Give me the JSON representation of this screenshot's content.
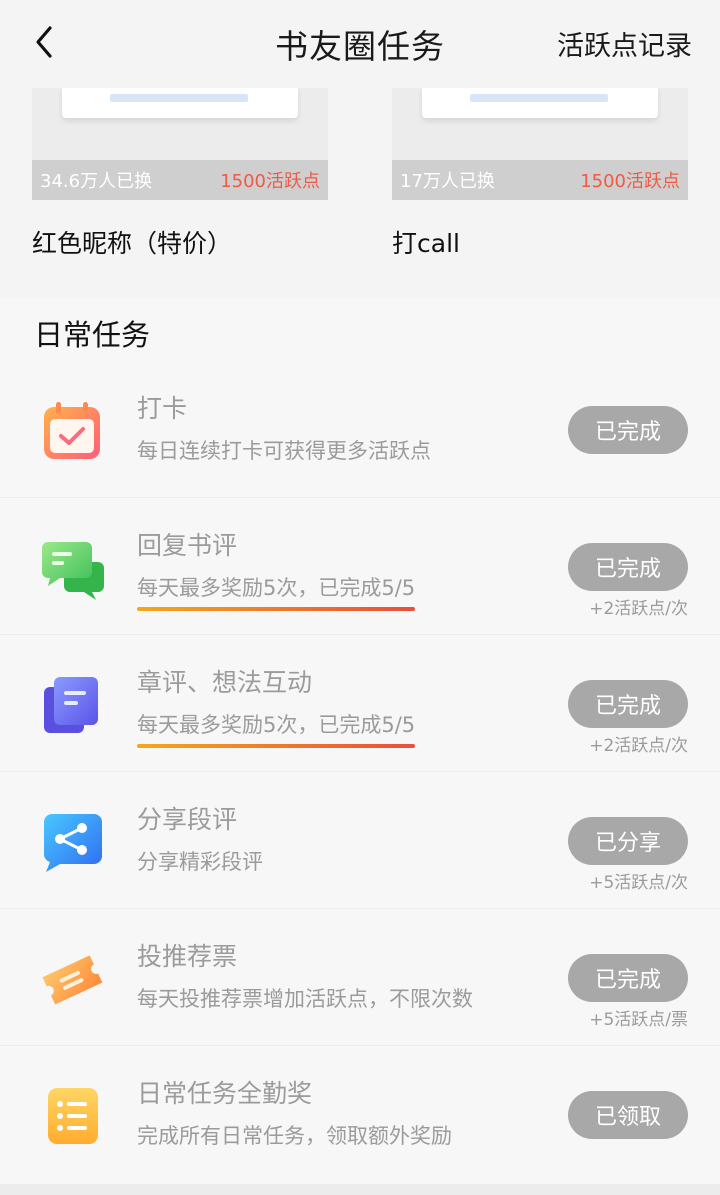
{
  "header": {
    "title": "书友圈任务",
    "record_link": "活跃点记录"
  },
  "rewards": [
    {
      "count": "34.6万人已换",
      "price": "1500活跃点",
      "name": "红色昵称（特价）"
    },
    {
      "count": "17万人已换",
      "price": "1500活跃点",
      "name": "打call"
    }
  ],
  "daily": {
    "title": "日常任务",
    "tasks": [
      {
        "icon": "calendar-check-icon",
        "name": "打卡",
        "desc": "每日连续打卡可获得更多活跃点",
        "status": "已完成",
        "note": ""
      },
      {
        "icon": "chat-bubble-icon",
        "name": "回复书评",
        "desc": "每天最多奖励5次，已完成5/5",
        "status": "已完成",
        "note": "+2活跃点/次"
      },
      {
        "icon": "note-cards-icon",
        "name": "章评、想法互动",
        "desc": "每天最多奖励5次，已完成5/5",
        "status": "已完成",
        "note": "+2活跃点/次"
      },
      {
        "icon": "share-icon",
        "name": "分享段评",
        "desc": "分享精彩段评",
        "status": "已分享",
        "note": "+5活跃点/次"
      },
      {
        "icon": "ticket-icon",
        "name": "投推荐票",
        "desc": "每天投推荐票增加活跃点，不限次数",
        "status": "已完成",
        "note": "+5活跃点/票"
      },
      {
        "icon": "list-icon",
        "name": "日常任务全勤奖",
        "desc": "完成所有日常任务，领取额外奖励",
        "status": "已领取",
        "note": ""
      }
    ]
  }
}
